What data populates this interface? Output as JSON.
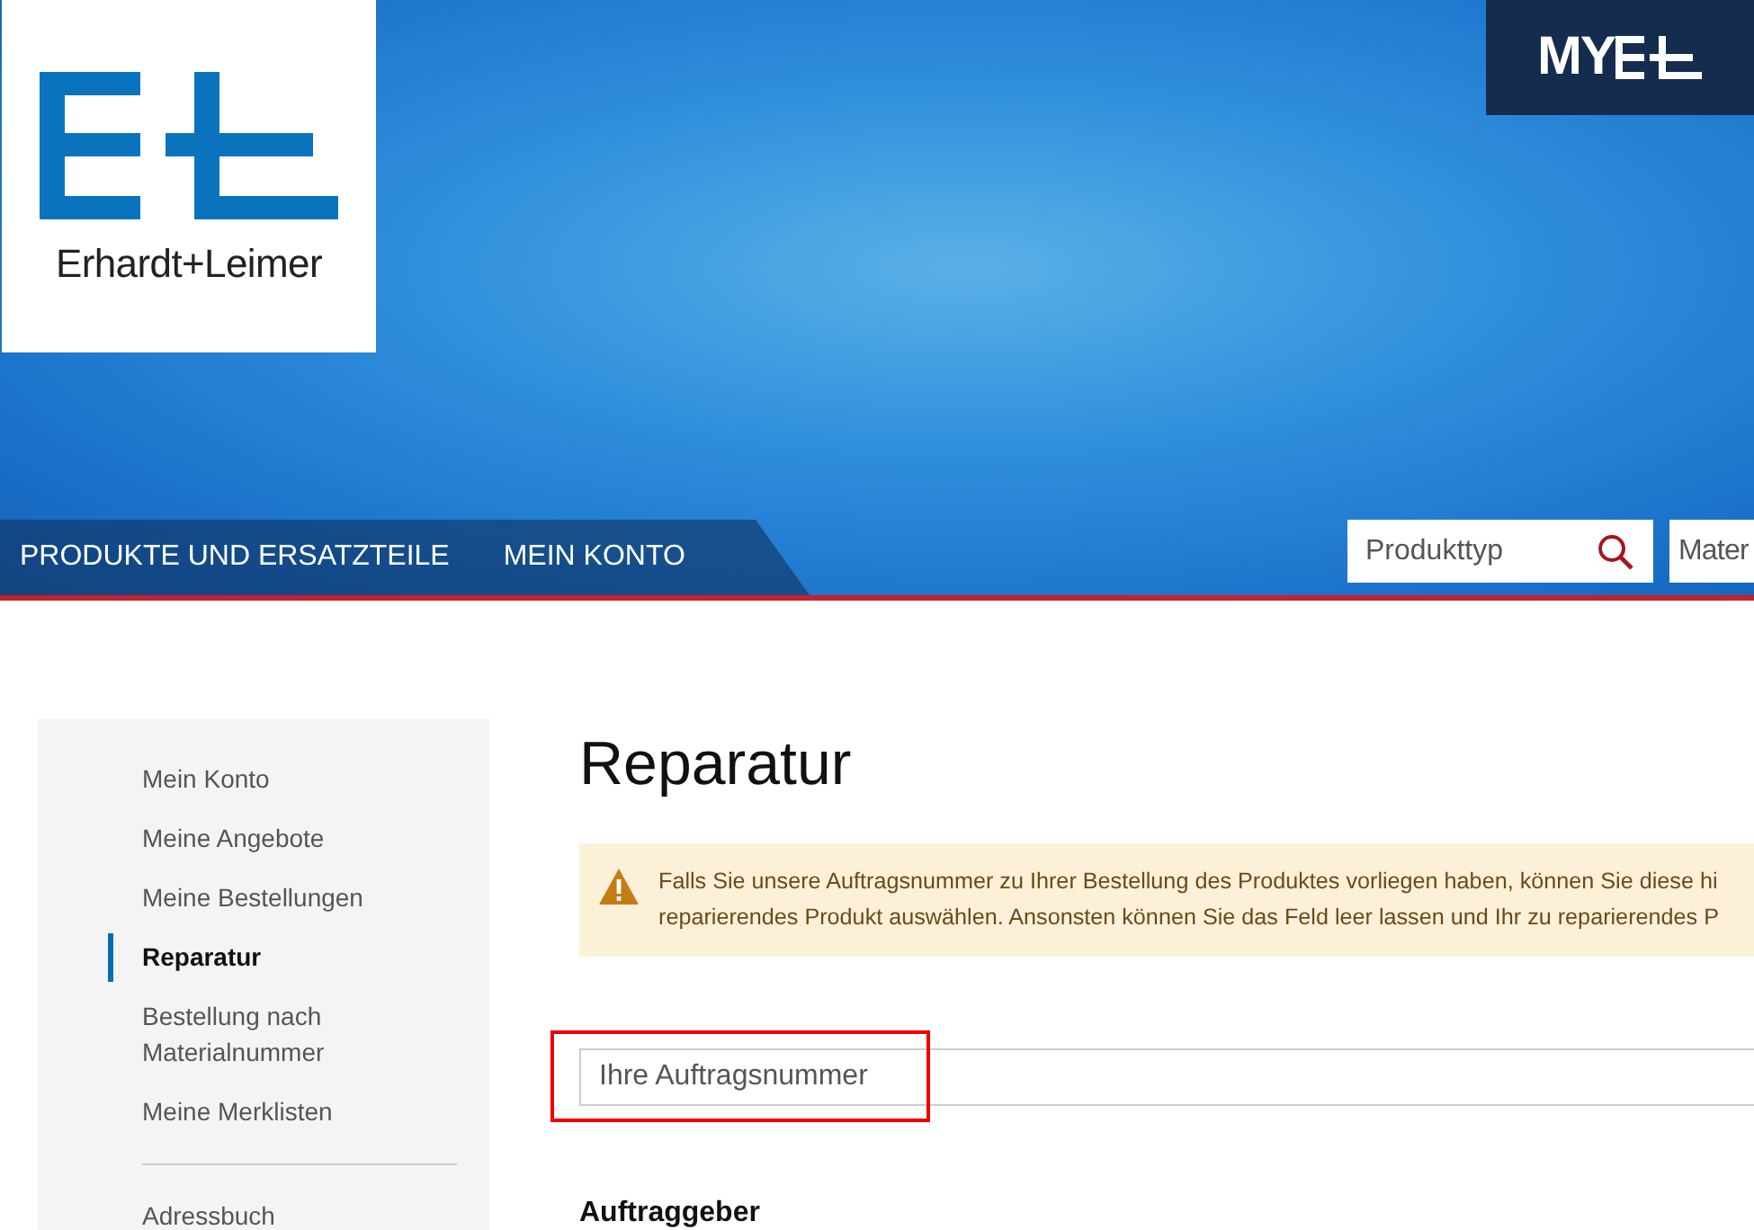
{
  "logo": {
    "name": "Erhardt+Leimer"
  },
  "badge": {
    "text": "MY"
  },
  "nav": {
    "items": [
      {
        "label": "PRODUKTE UND ERSATZTEILE"
      },
      {
        "label": "MEIN KONTO"
      }
    ]
  },
  "searches": [
    {
      "placeholder": "Produkttyp",
      "icon": true
    },
    {
      "placeholder": "Mater",
      "icon": false
    }
  ],
  "sidebar": {
    "items": [
      {
        "label": "Mein Konto",
        "selected": false,
        "kind": "link"
      },
      {
        "label": "Meine Angebote",
        "selected": false,
        "kind": "link"
      },
      {
        "label": "Meine Bestellungen",
        "selected": false,
        "kind": "link"
      },
      {
        "label": "Reparatur",
        "selected": true,
        "kind": "link"
      },
      {
        "label": "Bestellung nach Materialnummer",
        "selected": false,
        "kind": "link"
      },
      {
        "label": "Meine Merklisten",
        "selected": false,
        "kind": "link"
      },
      {
        "kind": "divider"
      },
      {
        "label": "Adressbuch",
        "selected": false,
        "kind": "link"
      }
    ]
  },
  "page": {
    "title": "Reparatur",
    "alert": {
      "lines": [
        "Falls Sie unsere Auftragsnummer zu Ihrer Bestellung des Produktes vorliegen haben, können Sie diese hi",
        "reparierendes Produkt auswählen. Ansonsten können Sie das Feld leer lassen und Ihr zu reparierendes P"
      ]
    },
    "order_field": {
      "placeholder": "Ihre Auftragsnummer",
      "highlighted": true
    },
    "section_title": "Auftraggeber"
  }
}
